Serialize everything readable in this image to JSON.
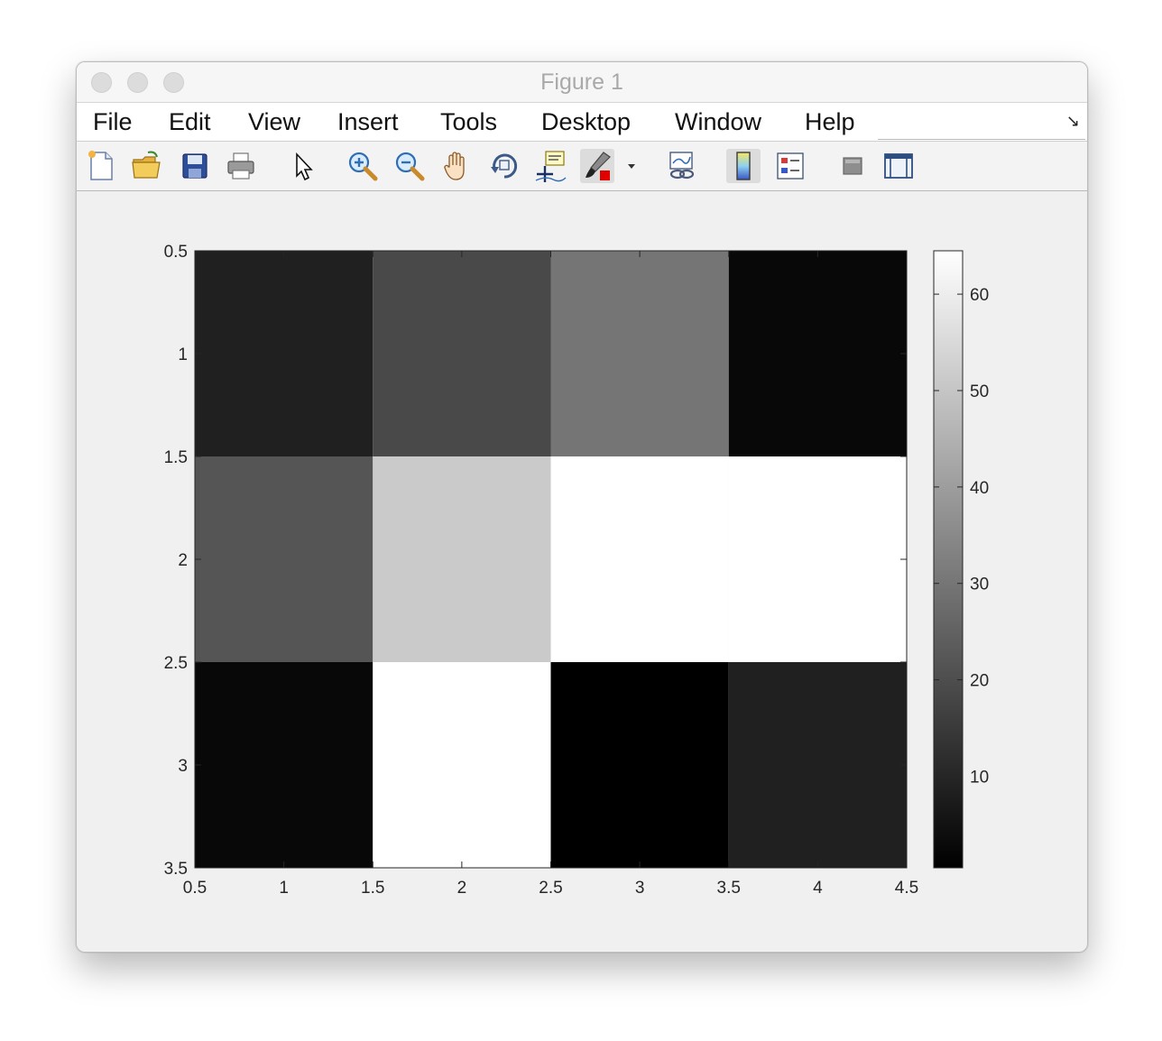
{
  "window": {
    "title": "Figure 1"
  },
  "menu": [
    "File",
    "Edit",
    "View",
    "Insert",
    "Tools",
    "Desktop",
    "Window",
    "Help"
  ],
  "toolbar": {
    "icons": [
      "new-figure-icon",
      "open-file-icon",
      "save-icon",
      "print-icon",
      "pointer-icon",
      "zoom-in-icon",
      "zoom-out-icon",
      "pan-hand-icon",
      "rotate-3d-icon",
      "data-cursor-icon",
      "brush-icon",
      "dropdown-arrow-icon",
      "link-plot-icon",
      "colorbar-icon",
      "legend-icon",
      "hide-plot-tools-icon",
      "show-plot-tools-icon"
    ]
  },
  "chart_data": {
    "type": "heatmap",
    "colormap": "gray",
    "clim": [
      1,
      64
    ],
    "matrix": [
      [
        9,
        19,
        30,
        3
      ],
      [
        22,
        51,
        64,
        64
      ],
      [
        3,
        64,
        1,
        9
      ]
    ],
    "xlim": [
      0.5,
      4.5
    ],
    "ylim": [
      0.5,
      3.5
    ],
    "y_reversed": true,
    "xticks": [
      "0.5",
      "1",
      "1.5",
      "2",
      "2.5",
      "3",
      "3.5",
      "4",
      "4.5"
    ],
    "yticks": [
      "0.5",
      "1",
      "1.5",
      "2",
      "2.5",
      "3",
      "3.5"
    ],
    "colorbar": {
      "ticks": [
        "10",
        "20",
        "30",
        "40",
        "50",
        "60"
      ],
      "tick_values": [
        10,
        20,
        30,
        40,
        50,
        60
      ]
    }
  }
}
